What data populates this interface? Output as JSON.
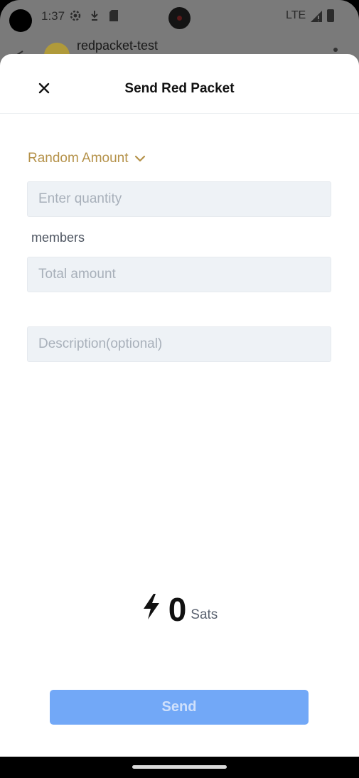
{
  "status_bar": {
    "time": "1:37",
    "network": "LTE",
    "icons": [
      "settings-icon",
      "download-icon",
      "sd-card-icon",
      "signal-icon",
      "battery-icon"
    ]
  },
  "background_chat": {
    "title": "redpacket-test"
  },
  "sheet": {
    "title": "Send Red Packet",
    "mode_label": "Random Amount",
    "quantity": {
      "value": "",
      "placeholder": "Enter quantity"
    },
    "unit_label": "members",
    "total_amount": {
      "value": "",
      "placeholder": "Total amount"
    },
    "description": {
      "value": "",
      "placeholder": "Description(optional)"
    },
    "amount_value": "0",
    "amount_unit": "Sats",
    "send_label": "Send"
  },
  "colors": {
    "accent_gold": "#b5924a",
    "send_button": "#72a8f7",
    "field_bg": "#eef2f6"
  }
}
